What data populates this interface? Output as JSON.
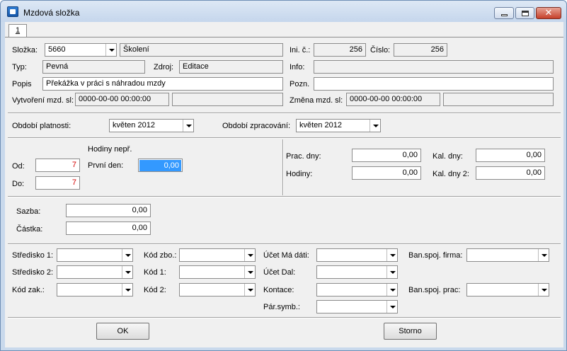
{
  "window": {
    "title": "Mzdová složka"
  },
  "tabs": [
    {
      "label": "1"
    }
  ],
  "header": {
    "slozka_label": "Složka:",
    "slozka_code": "5660",
    "slozka_name": "Školení",
    "ini_label": "Ini. č.:",
    "ini_value": "256",
    "cislo_label": "Číslo:",
    "cislo_value": "256",
    "typ_label": "Typ:",
    "typ_value": "Pevná",
    "zdroj_label": "Zdroj:",
    "zdroj_value": "Editace",
    "info_label": "Info:",
    "info_value": "",
    "popis_label": "Popis",
    "popis_value": "Překážka v práci s náhradou mzdy",
    "pozn_label": "Pozn.",
    "pozn_value": "",
    "vytvoreni_label": "Vytvoření mzd. sl:",
    "vytvoreni_value": "0000-00-00 00:00:00",
    "vytvoreni_user": "",
    "zmena_label": "Změna mzd. sl:",
    "zmena_value": "0000-00-00 00:00:00",
    "zmena_user": ""
  },
  "periods": {
    "platnosti_label": "Období platnosti:",
    "platnosti_value": "květen 2012",
    "zpracovani_label": "Období zpracování:",
    "zpracovani_value": "květen 2012"
  },
  "days": {
    "od_label": "Od:",
    "od_value": "7",
    "do_label": "Do:",
    "do_value": "7",
    "hodiny_nepr_label": "Hodiny nepř.",
    "prvni_den_label": "První den:",
    "prvni_den_value": "0,00",
    "prac_dny_label": "Prac. dny:",
    "prac_dny_value": "0,00",
    "hodiny_label": "Hodiny:",
    "hodiny_value": "0,00",
    "kal_dny_label": "Kal. dny:",
    "kal_dny_value": "0,00",
    "kal_dny2_label": "Kal. dny 2:",
    "kal_dny2_value": "0,00"
  },
  "amounts": {
    "sazba_label": "Sazba:",
    "sazba_value": "0,00",
    "castka_label": "Částka:",
    "castka_value": "0,00"
  },
  "accounting": {
    "stredisko1_label": "Středisko 1:",
    "stredisko1_value": "",
    "stredisko2_label": "Středisko 2:",
    "stredisko2_value": "",
    "kod_zak_label": "Kód zak.:",
    "kod_zak_value": "",
    "kod_zbo_label": "Kód zbo.:",
    "kod_zbo_value": "",
    "kod1_label": "Kód 1:",
    "kod1_value": "",
    "kod2_label": "Kód 2:",
    "kod2_value": "",
    "ucet_ma_dati_label": "Účet Má dáti:",
    "ucet_ma_dati_value": "",
    "ucet_dal_label": "Účet Dal:",
    "ucet_dal_value": "",
    "kontace_label": "Kontace:",
    "kontace_value": "",
    "par_symb_label": "Pár.symb.:",
    "par_symb_value": "",
    "ban_firma_label": "Ban.spoj. firma:",
    "ban_firma_value": "",
    "ban_prac_label": "Ban.spoj. prac:",
    "ban_prac_value": ""
  },
  "buttons": {
    "ok": "OK",
    "storno": "Storno"
  },
  "icons": {
    "app": "app-icon",
    "minimize": "minimize-icon",
    "maximize": "maximize-icon",
    "close": "close-icon",
    "dropdown": "chevron-down-icon"
  }
}
